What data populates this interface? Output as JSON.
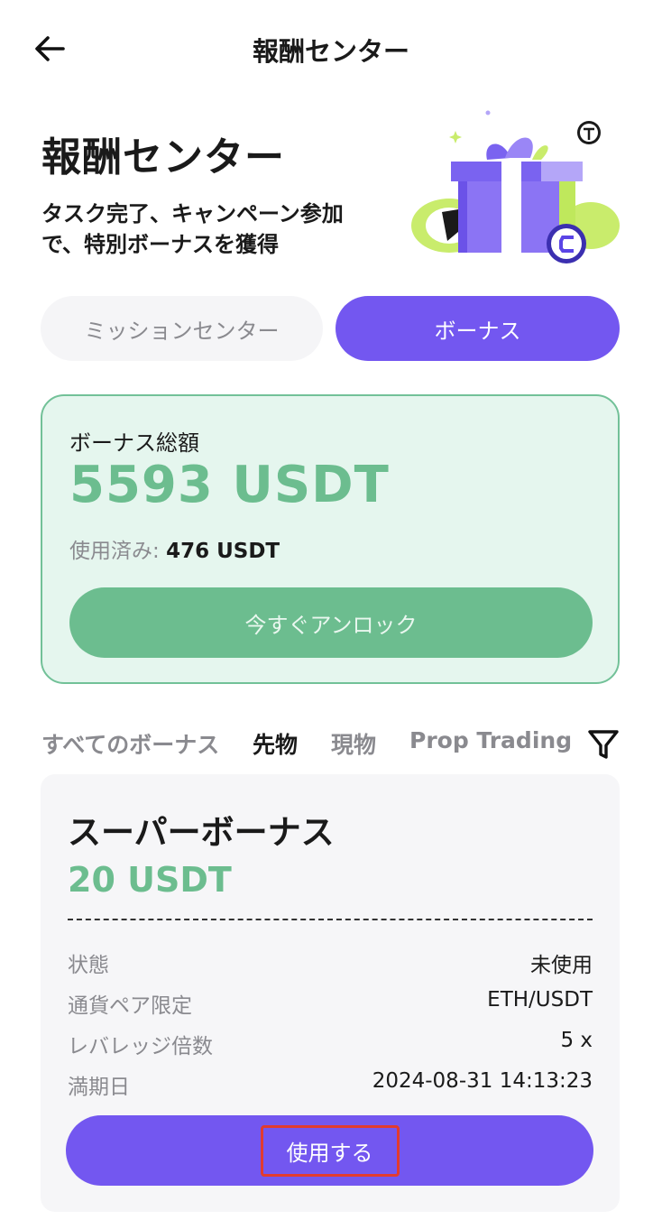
{
  "nav": {
    "title": "報酬センター",
    "back_icon": "arrow-left-icon"
  },
  "hero": {
    "title": "報酬センター",
    "subtitle": "タスク完了、キャンペーン参加で、特別ボーナスを獲得",
    "illustration": "gift-box-illustration"
  },
  "segments": [
    {
      "label": "ミッションセンター",
      "active": false
    },
    {
      "label": "ボーナス",
      "active": true
    }
  ],
  "summary": {
    "label": "ボーナス総額",
    "amount": "5593 USDT",
    "used_label": "使用済み:",
    "used_value": "476 USDT",
    "unlock_label": "今すぐアンロック"
  },
  "filters": {
    "items": [
      "すべてのボーナス",
      "先物",
      "現物",
      "Prop Trading"
    ],
    "active_index": 1,
    "filter_icon": "funnel-icon"
  },
  "bonus_card": {
    "name": "スーパーボーナス",
    "value": "20 USDT",
    "rows": [
      {
        "label": "状態",
        "value": "未使用"
      },
      {
        "label": "通貨ペア限定",
        "value": "ETH/USDT"
      },
      {
        "label": "レバレッジ倍数",
        "value": "5 x"
      },
      {
        "label": "満期日",
        "value": "2024-08-31 14:13:23"
      }
    ],
    "use_label": "使用する"
  },
  "colors": {
    "accent": "#7357f0",
    "green": "#6cbd8f",
    "green_bg": "#e5f6ee",
    "highlight": "#e23b2f"
  }
}
